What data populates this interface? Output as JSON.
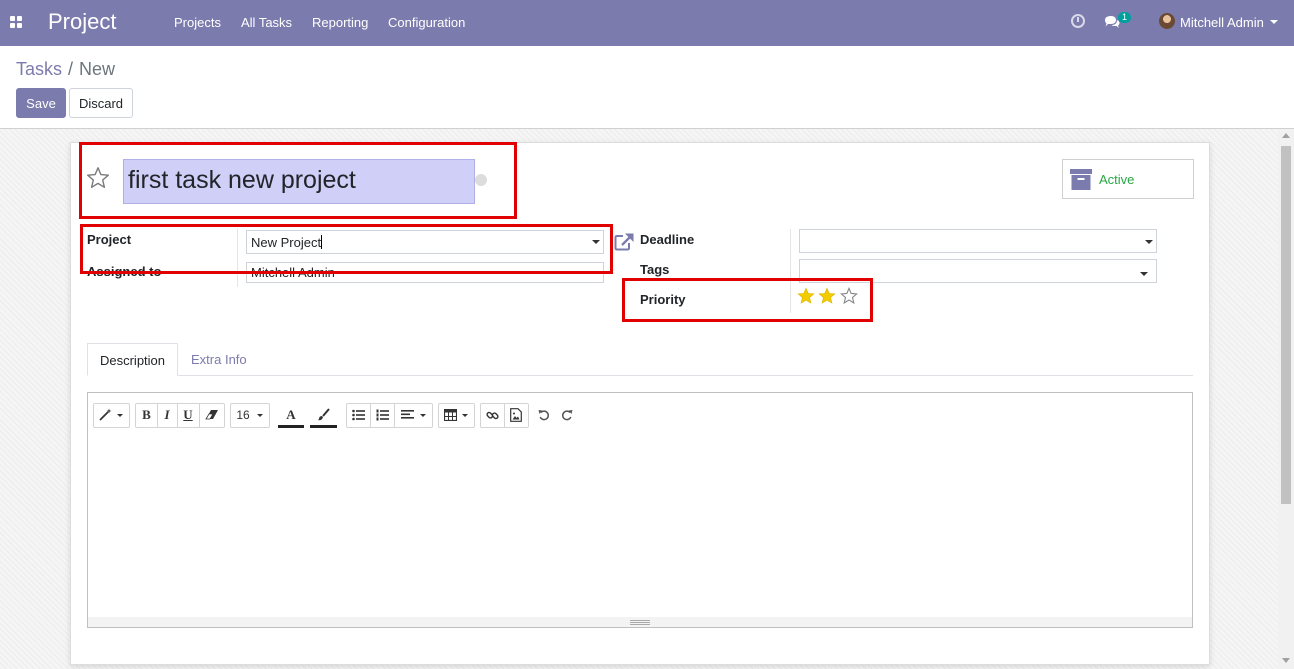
{
  "app": {
    "name": "Project",
    "menu": [
      "Projects",
      "All Tasks",
      "Reporting",
      "Configuration"
    ],
    "notifications_count": "1",
    "user_name": "Mitchell Admin"
  },
  "breadcrumb": {
    "parent": "Tasks",
    "separator": "/",
    "current": "New"
  },
  "actions": {
    "save_label": "Save",
    "discard_label": "Discard"
  },
  "form": {
    "title": "first task new project",
    "status_button": "Active",
    "fields": {
      "project_label": "Project",
      "project_value": "New Project",
      "assigned_label": "Assigned to",
      "assigned_value": "Mitchell Admin",
      "deadline_label": "Deadline",
      "deadline_value": "",
      "tags_label": "Tags",
      "tags_value": "",
      "priority_label": "Priority",
      "priority_stars": 3,
      "priority_filled": 2
    },
    "tabs": [
      "Description",
      "Extra Info"
    ],
    "editor": {
      "font_size": "16",
      "bold": "B",
      "italic": "I",
      "underline": "U",
      "font_color": "A"
    }
  },
  "colors": {
    "brand": "#7c7bad",
    "highlight": "#e00000",
    "active_green": "#28a745",
    "star_gold": "#f3cc00"
  }
}
